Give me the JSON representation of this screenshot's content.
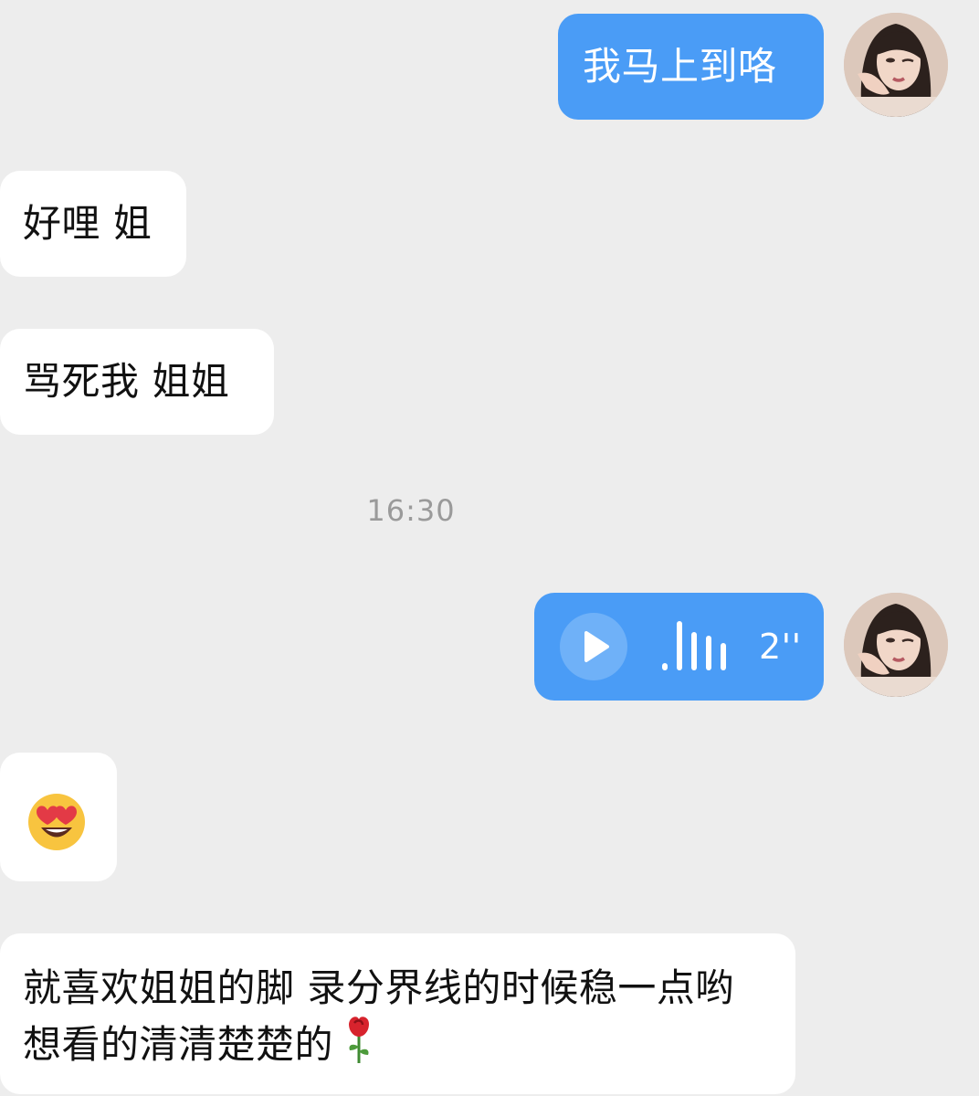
{
  "chat": {
    "messages": {
      "m1": {
        "text": "我马上到咯"
      },
      "m2": {
        "text": "好哩 姐"
      },
      "m3": {
        "text": "骂死我 姐姐"
      },
      "timestamp": "16:30",
      "voice": {
        "duration": "2''"
      },
      "m5": {
        "text": "😍"
      },
      "m6": {
        "text": "就喜欢姐姐的脚 录分界线的时候稳一点哟 想看的清清楚楚的"
      }
    }
  }
}
